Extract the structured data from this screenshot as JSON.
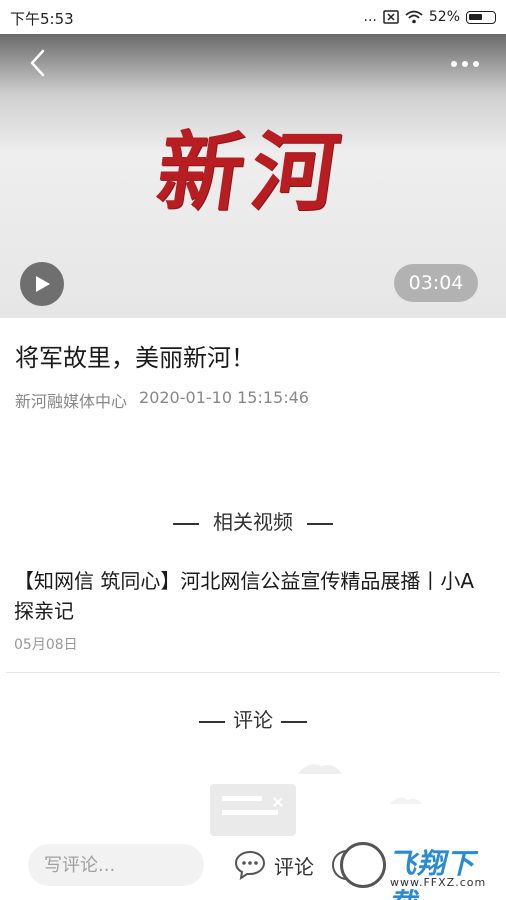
{
  "status_bar": {
    "time": "下午5:53",
    "dots": "...",
    "battery": "52%"
  },
  "video": {
    "logo_text": "新河",
    "duration": "03:04"
  },
  "article": {
    "title": "将军故里，美丽新河！",
    "source": "新河融媒体中心",
    "datetime": "2020-01-10 15:15:46"
  },
  "related": {
    "heading": "相关视频",
    "items": [
      {
        "title": "【知网信 筑同心】河北网信公益宣传精品展播丨小A探亲记",
        "date": "05月08日"
      }
    ]
  },
  "comments": {
    "heading": "评论"
  },
  "bottom_bar": {
    "input_placeholder": "写评论...",
    "comment_label": "评论"
  },
  "watermark": {
    "brand": "飞翔下载",
    "url": "www.FFXZ.com"
  },
  "colors": {
    "logo_red": "#b81d22",
    "watermark_blue": "#2a8ad4"
  }
}
